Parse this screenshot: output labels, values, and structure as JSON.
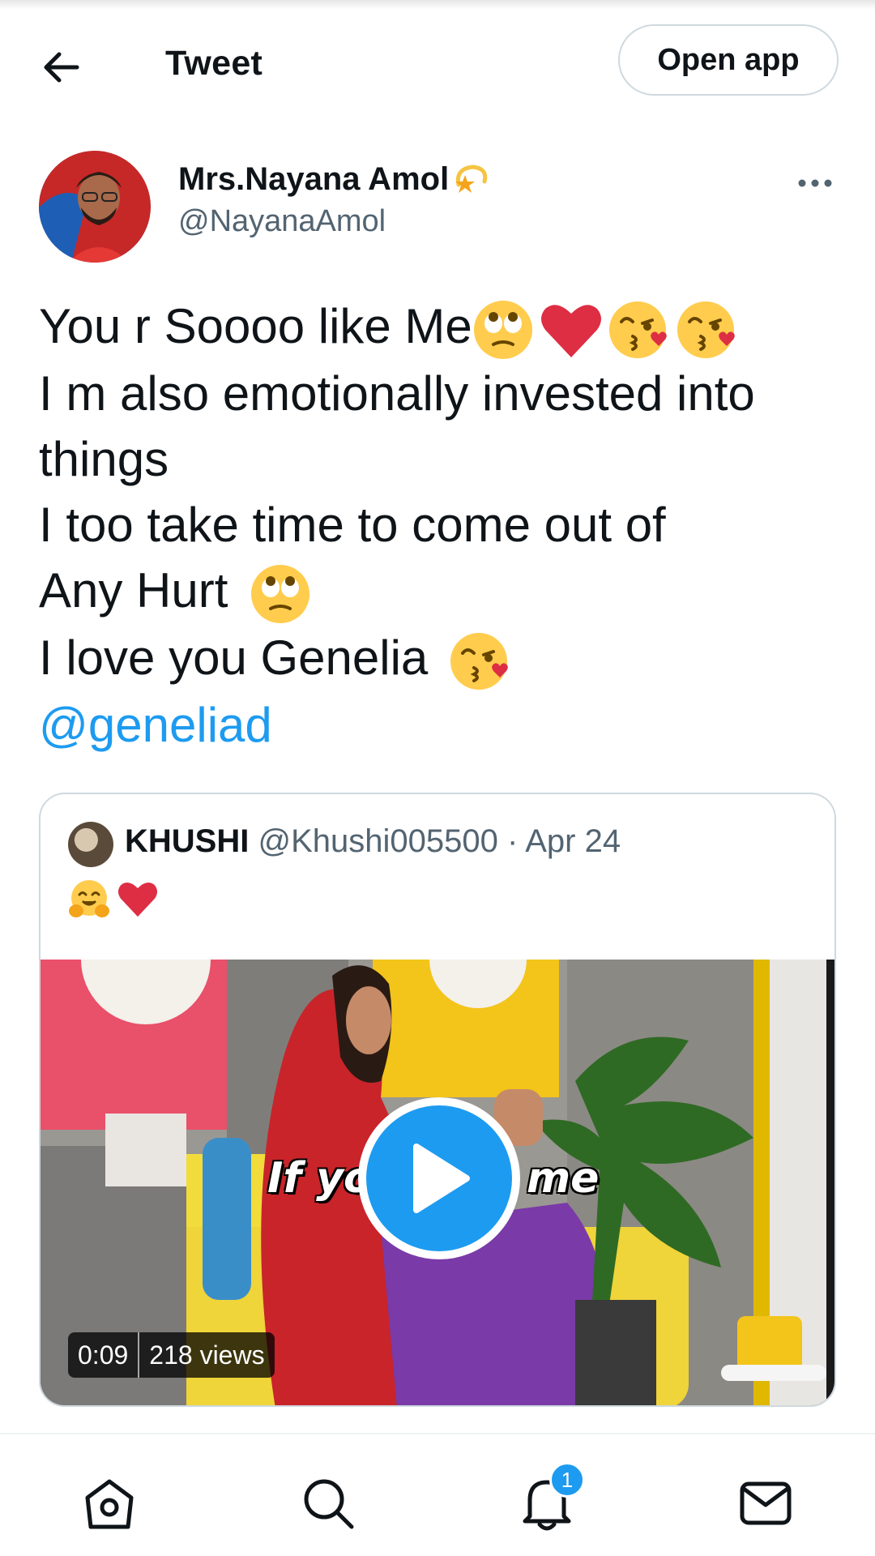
{
  "header": {
    "title": "Tweet",
    "open_app_label": "Open app",
    "back_icon": "arrow-left-icon"
  },
  "author": {
    "name": "Mrs.Nayana Amol",
    "name_emoji": "dizzy-star-emoji",
    "handle": "@NayanaAmol"
  },
  "tweet": {
    "lines": [
      "You r Soooo like Me",
      "I m also emotionally invested into",
      "things",
      "I too take time to come out of",
      "Any Hurt",
      "I love you Genelia"
    ],
    "mention": "@geneliad",
    "emojis_line1": [
      "face-with-rolling-eyes-emoji",
      "red-heart-emoji",
      "kissing-face-emoji",
      "kissing-face-emoji"
    ],
    "emojis_line5": [
      "face-with-rolling-eyes-emoji"
    ],
    "emojis_line6": [
      "kissing-face-emoji"
    ]
  },
  "quoted_tweet": {
    "name": "KHUSHI",
    "handle": "@Khushi005500",
    "separator": "·",
    "date": "Apr 24",
    "emojis": [
      "hugging-face-emoji",
      "red-heart-emoji"
    ],
    "video": {
      "duration": "0:09",
      "views": "218 views",
      "caption_left": "If yo",
      "caption_right": "me"
    }
  },
  "bottom_nav": {
    "items": [
      "home-icon",
      "search-icon",
      "notifications-icon",
      "messages-icon"
    ],
    "notification_count": "1"
  },
  "colors": {
    "accent": "#1d9bf0",
    "text": "#0f1419",
    "secondary_text": "#536471",
    "border": "#cfd9de"
  }
}
